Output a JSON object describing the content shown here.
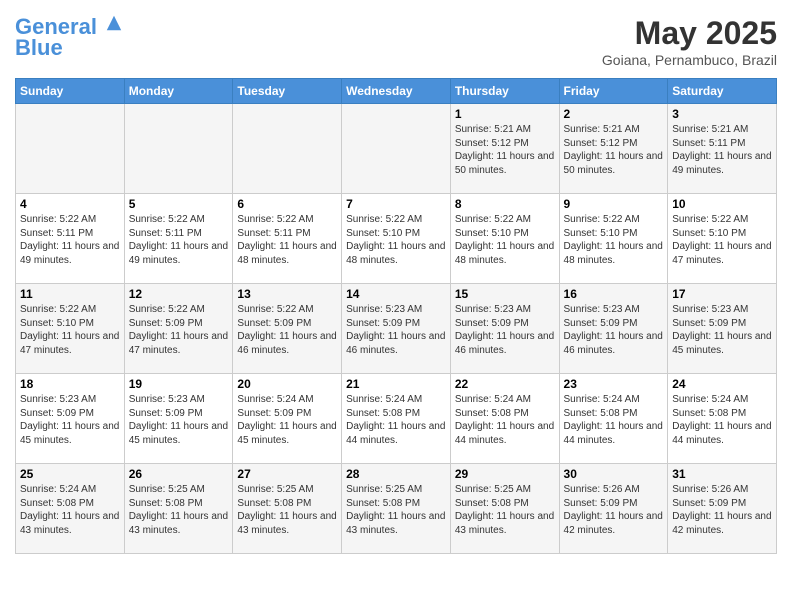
{
  "header": {
    "logo_line1": "General",
    "logo_line2": "Blue",
    "month": "May 2025",
    "location": "Goiana, Pernambuco, Brazil"
  },
  "days_of_week": [
    "Sunday",
    "Monday",
    "Tuesday",
    "Wednesday",
    "Thursday",
    "Friday",
    "Saturday"
  ],
  "weeks": [
    [
      {
        "day": "",
        "info": ""
      },
      {
        "day": "",
        "info": ""
      },
      {
        "day": "",
        "info": ""
      },
      {
        "day": "",
        "info": ""
      },
      {
        "day": "1",
        "info": "Sunrise: 5:21 AM\nSunset: 5:12 PM\nDaylight: 11 hours and 50 minutes."
      },
      {
        "day": "2",
        "info": "Sunrise: 5:21 AM\nSunset: 5:12 PM\nDaylight: 11 hours and 50 minutes."
      },
      {
        "day": "3",
        "info": "Sunrise: 5:21 AM\nSunset: 5:11 PM\nDaylight: 11 hours and 49 minutes."
      }
    ],
    [
      {
        "day": "4",
        "info": "Sunrise: 5:22 AM\nSunset: 5:11 PM\nDaylight: 11 hours and 49 minutes."
      },
      {
        "day": "5",
        "info": "Sunrise: 5:22 AM\nSunset: 5:11 PM\nDaylight: 11 hours and 49 minutes."
      },
      {
        "day": "6",
        "info": "Sunrise: 5:22 AM\nSunset: 5:11 PM\nDaylight: 11 hours and 48 minutes."
      },
      {
        "day": "7",
        "info": "Sunrise: 5:22 AM\nSunset: 5:10 PM\nDaylight: 11 hours and 48 minutes."
      },
      {
        "day": "8",
        "info": "Sunrise: 5:22 AM\nSunset: 5:10 PM\nDaylight: 11 hours and 48 minutes."
      },
      {
        "day": "9",
        "info": "Sunrise: 5:22 AM\nSunset: 5:10 PM\nDaylight: 11 hours and 48 minutes."
      },
      {
        "day": "10",
        "info": "Sunrise: 5:22 AM\nSunset: 5:10 PM\nDaylight: 11 hours and 47 minutes."
      }
    ],
    [
      {
        "day": "11",
        "info": "Sunrise: 5:22 AM\nSunset: 5:10 PM\nDaylight: 11 hours and 47 minutes."
      },
      {
        "day": "12",
        "info": "Sunrise: 5:22 AM\nSunset: 5:09 PM\nDaylight: 11 hours and 47 minutes."
      },
      {
        "day": "13",
        "info": "Sunrise: 5:22 AM\nSunset: 5:09 PM\nDaylight: 11 hours and 46 minutes."
      },
      {
        "day": "14",
        "info": "Sunrise: 5:23 AM\nSunset: 5:09 PM\nDaylight: 11 hours and 46 minutes."
      },
      {
        "day": "15",
        "info": "Sunrise: 5:23 AM\nSunset: 5:09 PM\nDaylight: 11 hours and 46 minutes."
      },
      {
        "day": "16",
        "info": "Sunrise: 5:23 AM\nSunset: 5:09 PM\nDaylight: 11 hours and 46 minutes."
      },
      {
        "day": "17",
        "info": "Sunrise: 5:23 AM\nSunset: 5:09 PM\nDaylight: 11 hours and 45 minutes."
      }
    ],
    [
      {
        "day": "18",
        "info": "Sunrise: 5:23 AM\nSunset: 5:09 PM\nDaylight: 11 hours and 45 minutes."
      },
      {
        "day": "19",
        "info": "Sunrise: 5:23 AM\nSunset: 5:09 PM\nDaylight: 11 hours and 45 minutes."
      },
      {
        "day": "20",
        "info": "Sunrise: 5:24 AM\nSunset: 5:09 PM\nDaylight: 11 hours and 45 minutes."
      },
      {
        "day": "21",
        "info": "Sunrise: 5:24 AM\nSunset: 5:08 PM\nDaylight: 11 hours and 44 minutes."
      },
      {
        "day": "22",
        "info": "Sunrise: 5:24 AM\nSunset: 5:08 PM\nDaylight: 11 hours and 44 minutes."
      },
      {
        "day": "23",
        "info": "Sunrise: 5:24 AM\nSunset: 5:08 PM\nDaylight: 11 hours and 44 minutes."
      },
      {
        "day": "24",
        "info": "Sunrise: 5:24 AM\nSunset: 5:08 PM\nDaylight: 11 hours and 44 minutes."
      }
    ],
    [
      {
        "day": "25",
        "info": "Sunrise: 5:24 AM\nSunset: 5:08 PM\nDaylight: 11 hours and 43 minutes."
      },
      {
        "day": "26",
        "info": "Sunrise: 5:25 AM\nSunset: 5:08 PM\nDaylight: 11 hours and 43 minutes."
      },
      {
        "day": "27",
        "info": "Sunrise: 5:25 AM\nSunset: 5:08 PM\nDaylight: 11 hours and 43 minutes."
      },
      {
        "day": "28",
        "info": "Sunrise: 5:25 AM\nSunset: 5:08 PM\nDaylight: 11 hours and 43 minutes."
      },
      {
        "day": "29",
        "info": "Sunrise: 5:25 AM\nSunset: 5:08 PM\nDaylight: 11 hours and 43 minutes."
      },
      {
        "day": "30",
        "info": "Sunrise: 5:26 AM\nSunset: 5:09 PM\nDaylight: 11 hours and 42 minutes."
      },
      {
        "day": "31",
        "info": "Sunrise: 5:26 AM\nSunset: 5:09 PM\nDaylight: 11 hours and 42 minutes."
      }
    ]
  ]
}
